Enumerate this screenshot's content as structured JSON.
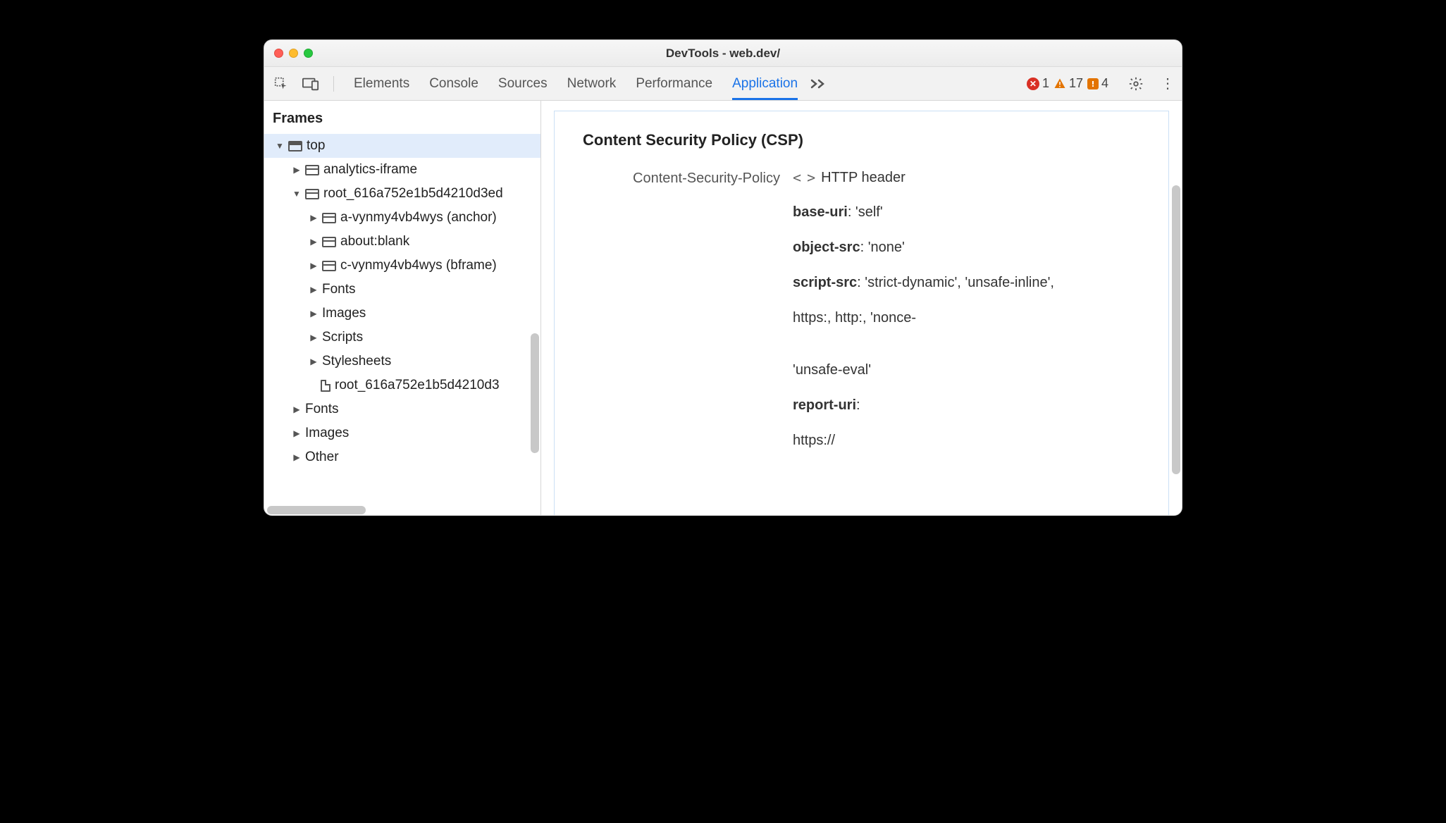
{
  "window": {
    "title": "DevTools - web.dev/"
  },
  "tabs": {
    "items": [
      "Elements",
      "Console",
      "Sources",
      "Network",
      "Performance",
      "Application"
    ],
    "active": "Application"
  },
  "counts": {
    "errors": "1",
    "warnings": "17",
    "issues": "4"
  },
  "sidebar": {
    "header": "Frames",
    "tree": {
      "top": "top",
      "analytics": "analytics-iframe",
      "root": "root_616a752e1b5d4210d3ed",
      "anchor": "a-vynmy4vb4wys (anchor)",
      "blank": "about:blank",
      "bframe": "c-vynmy4vb4wys (bframe)",
      "fonts": "Fonts",
      "images": "Images",
      "scripts": "Scripts",
      "stylesheets": "Stylesheets",
      "doc": "root_616a752e1b5d4210d3",
      "fonts2": "Fonts",
      "images2": "Images",
      "other": "Other"
    }
  },
  "panel": {
    "heading": "Content Security Policy (CSP)",
    "label": "Content-Security-Policy",
    "source": "HTTP header",
    "directives": {
      "base_uri_k": "base-uri",
      "base_uri_v": ": 'self'",
      "object_src_k": "object-src",
      "object_src_v": ": 'none'",
      "script_src_k": "script-src",
      "script_src_v": ": 'strict-dynamic', 'unsafe-inline',",
      "script_src_line2": "https:, http:, 'nonce-",
      "unsafe_eval": "'unsafe-eval'",
      "report_uri_k": "report-uri",
      "report_uri_v": ":",
      "report_uri_line2": "https://"
    }
  }
}
